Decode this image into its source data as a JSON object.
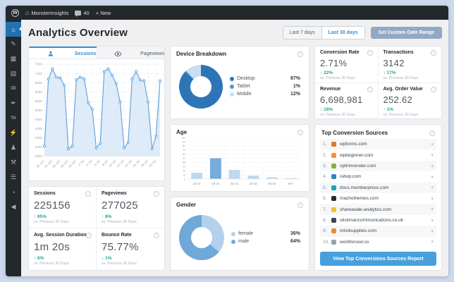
{
  "admin_bar": {
    "site_name": "MonsterInsights",
    "comments_count": "40",
    "new_label": "+ New"
  },
  "sidebar": {
    "items": [
      {
        "name": "dashboard",
        "glyph": "⌂",
        "active": true
      },
      {
        "name": "posts",
        "glyph": "✎"
      },
      {
        "name": "media",
        "glyph": "▦"
      },
      {
        "name": "pages",
        "glyph": "▤"
      },
      {
        "name": "comments",
        "glyph": "✉"
      },
      {
        "name": "appearance",
        "glyph": "✒"
      },
      {
        "name": "ta-plugin",
        "glyph": "TA"
      },
      {
        "name": "plugins",
        "glyph": "⚡"
      },
      {
        "name": "users",
        "glyph": "♟"
      },
      {
        "name": "tools",
        "glyph": "⚒"
      },
      {
        "name": "settings",
        "glyph": "☰"
      },
      {
        "name": "insights",
        "glyph": "◔"
      },
      {
        "name": "collapse",
        "glyph": "◀"
      }
    ]
  },
  "header": {
    "title": "Analytics Overview",
    "last7": "Last 7 days",
    "last30": "Last 30 days",
    "custom": "Set Custom Date Range"
  },
  "tabs": {
    "sessions": "Sessions",
    "pageviews": "Pageviews"
  },
  "chart_data": [
    {
      "id": "sessions_over_time",
      "type": "area",
      "title": "Sessions",
      "x": [
        "22 Jun",
        "23 Jun",
        "24 Jun",
        "25 Jun",
        "26 Jun",
        "27 Jun",
        "28 Jun",
        "29 Jun",
        "30 Jun",
        "1 Jul",
        "2 Jul",
        "3 Jul",
        "4 Jul",
        "5 Jul",
        "6 Jul",
        "7 Jul",
        "8 Jul",
        "9 Jul",
        "10 Jul",
        "11 Jul",
        "12 Jul",
        "13 Jul",
        "14 Jul",
        "15 Jul",
        "16 Jul",
        "17 Jul",
        "18 Jul",
        "19 Jul",
        "20 Jul",
        "21 Jul"
      ],
      "values": [
        3050,
        6700,
        7250,
        6800,
        6750,
        6350,
        2900,
        3050,
        6650,
        6800,
        6700,
        5400,
        5050,
        2950,
        3200,
        7100,
        7250,
        6900,
        6450,
        5450,
        2950,
        3250,
        6700,
        7100,
        6650,
        6600,
        5450,
        2900,
        3600,
        6600
      ],
      "ylim": [
        2500,
        7500
      ],
      "ytick_step": 500,
      "x_tick_every": 2,
      "grid": true,
      "line_color": "#5f9fd8",
      "fill_color": "#d6e6f7"
    },
    {
      "id": "device_breakdown",
      "type": "pie",
      "title": "Device Breakdown",
      "labels": [
        "Desktop",
        "Tablet",
        "Mobile"
      ],
      "values": [
        87,
        1,
        12
      ],
      "colors": [
        "#2e75b6",
        "#4f97d4",
        "#c7def4"
      ],
      "legend_position": "right"
    },
    {
      "id": "age",
      "type": "bar",
      "title": "Age",
      "categories": [
        "18-24",
        "25-34",
        "35-44",
        "45-54",
        "55-64",
        "65+"
      ],
      "values": [
        15,
        50,
        22,
        8,
        4,
        2
      ],
      "ylim": [
        0,
        100
      ],
      "ytick_step": 10,
      "grid": true,
      "bar_color": "#bdd8f1",
      "highlight_color": "#78abdd",
      "highlight_index": 1
    },
    {
      "id": "gender",
      "type": "pie",
      "title": "Gender",
      "labels": [
        "female",
        "male"
      ],
      "values": [
        36,
        64
      ],
      "colors": [
        "#b3d1ec",
        "#6fa8d9"
      ],
      "legend_position": "right"
    }
  ],
  "stats": {
    "sessions": {
      "label": "Sessions",
      "value": "225156",
      "change": "↑ 85%",
      "note": "vs. Previous 30 Days"
    },
    "pageviews": {
      "label": "Pageviews",
      "value": "277025",
      "change": "↑ 8%",
      "note": "vs. Previous 30 Days"
    },
    "duration": {
      "label": "Avg. Session Duration",
      "value": "1m 20s",
      "change": "↑ 6%",
      "note": "vs. Previous 30 Days"
    },
    "bounce": {
      "label": "Bounce Rate",
      "value": "75.77%",
      "change": "↓ 1%",
      "note": "vs. Previous 30 Days"
    },
    "conversion": {
      "label": "Conversion Rate",
      "value": "2.71%",
      "change": "↑ 22%",
      "note": "vs. Previous 30 Days"
    },
    "transactions": {
      "label": "Transactions",
      "value": "3142",
      "change": "↑ 17%",
      "note": "vs. Previous 30 Days"
    },
    "revenue": {
      "label": "Revenue",
      "value": "6,698,981",
      "change": "↑ 16%",
      "note": "vs. Previous 30 Days"
    },
    "avg_order": {
      "label": "Avg. Order Value",
      "value": "252.62",
      "change": "↑ 1%",
      "note": "vs. Previous 30 Days"
    }
  },
  "panels": {
    "device": {
      "title": "Device Breakdown"
    },
    "age": {
      "title": "Age"
    },
    "gender": {
      "title": "Gender"
    }
  },
  "sources": {
    "title": "Top Conversion Sources",
    "button": "View Top Conversions Sources Report",
    "items": [
      {
        "rank": "1.",
        "domain": "wpforms.com",
        "color": "#e27730"
      },
      {
        "rank": "2.",
        "domain": "wpbeginner.com",
        "color": "#ff8c2e"
      },
      {
        "rank": "3.",
        "domain": "optinmonster.com",
        "color": "#83b53a"
      },
      {
        "rank": "4.",
        "domain": "isitwp.com",
        "color": "#2d87c3"
      },
      {
        "rank": "5.",
        "domain": "docs.memberpress.com",
        "color": "#12a5b8"
      },
      {
        "rank": "6.",
        "domain": "machothemes.com",
        "color": "#2b2b2b"
      },
      {
        "rank": "7.",
        "domain": "shareasale-analytics.com",
        "color": "#f2c230"
      },
      {
        "rank": "8.",
        "domain": "stickmancommunications.co.uk",
        "color": "#3d4752"
      },
      {
        "rank": "9.",
        "domain": "mindsupplies.com",
        "color": "#ef8b2f"
      },
      {
        "rank": "10.",
        "domain": "workforcexl.co",
        "color": "#9aa3ad"
      }
    ]
  }
}
